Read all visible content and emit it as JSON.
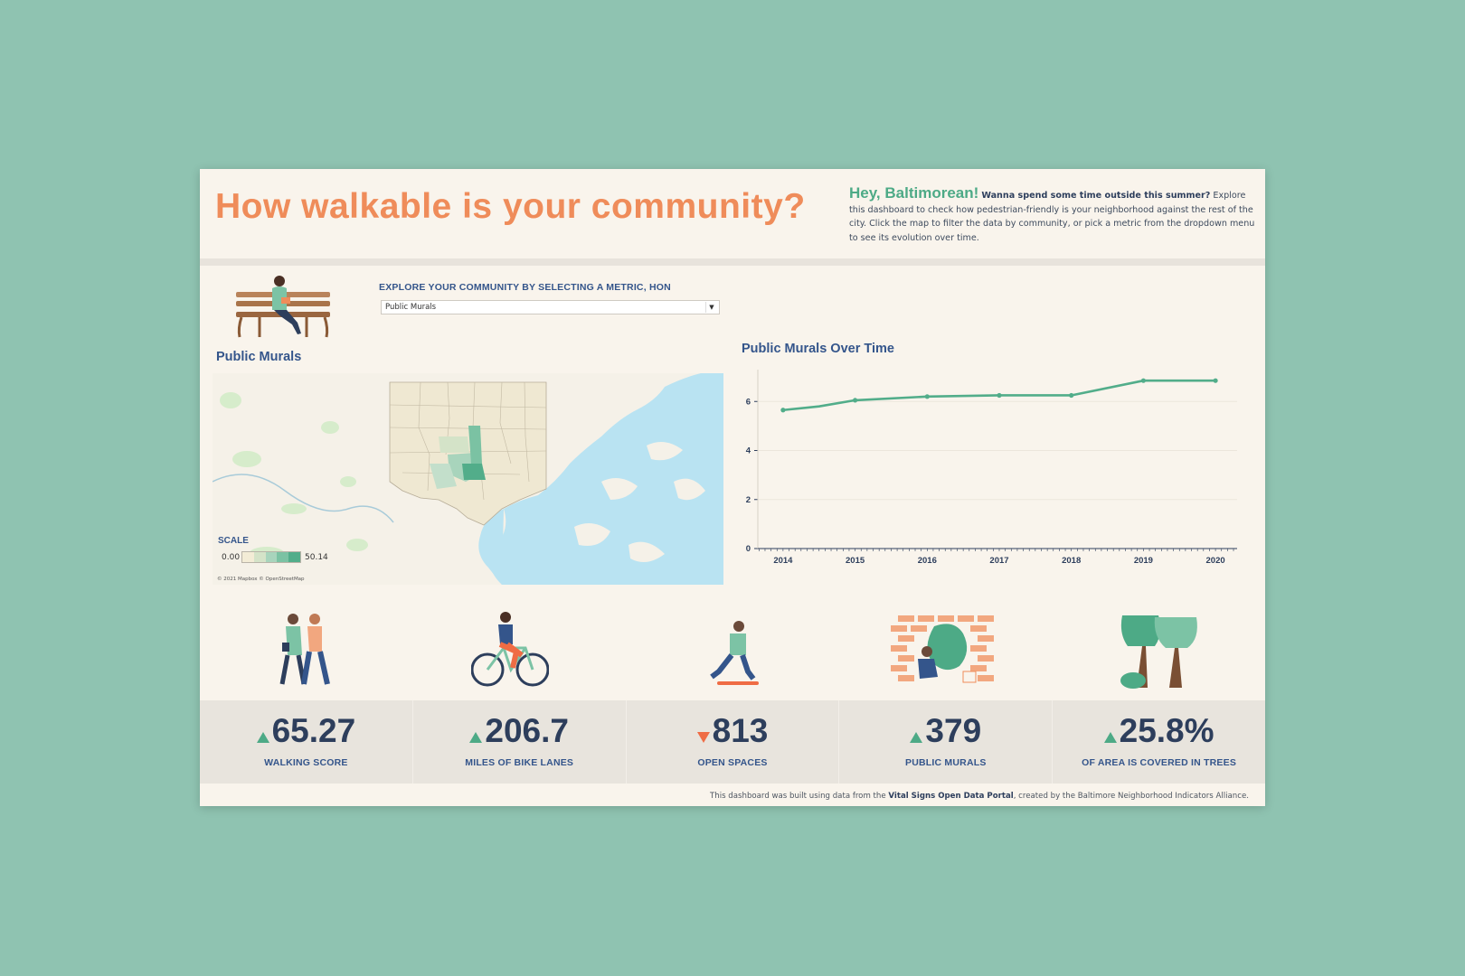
{
  "header": {
    "title": "How walkable is your community?",
    "greeting": "Hey, Baltimorean!",
    "tagline": "Wanna spend some time outside this summer?",
    "intro": "Explore this dashboard to check how pedestrian-friendly is your neighborhood against the rest of the city. Click the map to filter the data by community, or pick a metric from the dropdown menu to see its evolution over time."
  },
  "control": {
    "label": "EXPLORE YOUR COMMUNITY BY SELECTING A METRIC, HON",
    "selected": "Public Murals"
  },
  "map": {
    "title": "Public Murals",
    "scale_title": "SCALE",
    "scale_min": "0.00",
    "scale_max": "50.14",
    "scale_colors": [
      "#f3ecd6",
      "#d4e3c8",
      "#a8d4bc",
      "#7bc2a3",
      "#52ad8a"
    ],
    "attribution": "© 2021 Mapbox © OpenStreetMap",
    "colors": {
      "water": "#b9e3f2",
      "land": "#f5f1e8",
      "park": "#d3ecc8",
      "highlight": "#52ad8a"
    }
  },
  "chart_data": {
    "type": "line",
    "title": "Public Murals Over Time",
    "x": [
      2014,
      2014.5,
      2015,
      2016,
      2017,
      2018,
      2019,
      2020
    ],
    "y": [
      5.65,
      5.8,
      6.05,
      6.2,
      6.25,
      6.25,
      6.85,
      6.85
    ],
    "xticks": [
      "2014",
      "2015",
      "2016",
      "2017",
      "2018",
      "2019",
      "2020"
    ],
    "yticks": [
      "0",
      "2",
      "4",
      "6"
    ],
    "xlim": [
      2013.65,
      2020.3
    ],
    "ylim": [
      0,
      7.3
    ],
    "grid": true,
    "color": "#52ad8a"
  },
  "kpis": [
    {
      "value": "65.27",
      "label": "WALKING SCORE",
      "trend": "up"
    },
    {
      "value": "206.7",
      "label": "MILES OF BIKE LANES",
      "trend": "up"
    },
    {
      "value": "813",
      "label": "OPEN SPACES",
      "trend": "down"
    },
    {
      "value": "379",
      "label": "PUBLIC MURALS",
      "trend": "up"
    },
    {
      "value": "25.8%",
      "label": "OF AREA IS COVERED IN TREES",
      "trend": "up"
    }
  ],
  "footer": {
    "pre": "This dashboard was built using data from the ",
    "link": "Vital Signs Open Data Portal",
    "post": ", created by the Baltimore Neighborhood Indicators Alliance."
  },
  "icons": [
    "bench-person-icon",
    "walking-couple-icon",
    "cyclist-icon",
    "skateboarder-icon",
    "mural-painter-icon",
    "trees-icon",
    "dropdown-arrow-icon"
  ]
}
